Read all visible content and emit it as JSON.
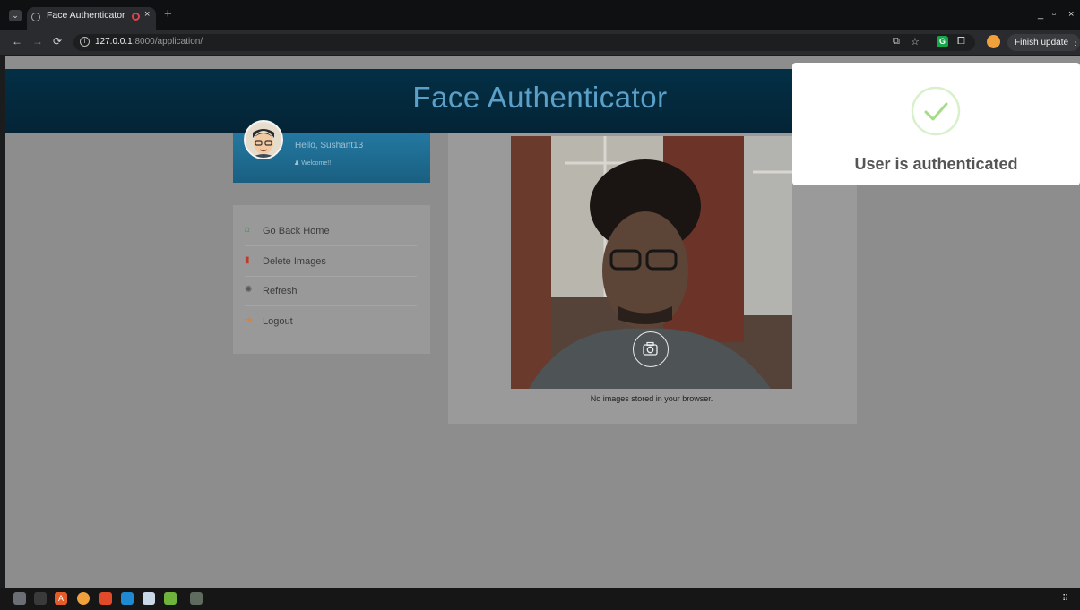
{
  "browser": {
    "tab_title": "Face Authenticator",
    "tab_close": "×",
    "new_tab": "+",
    "url_host": "127.0.0.1",
    "url_path": ":8000/application/",
    "finish_update_label": "Finish update",
    "window_controls": [
      "_",
      "▫",
      "×"
    ]
  },
  "page": {
    "app_title": "Face Authenticator",
    "profile": {
      "greeting": "Hello, Sushant13",
      "welcome": "Welcome!!"
    },
    "menu": [
      {
        "icon": "home-icon",
        "label": "Go Back Home",
        "color": "#2e8b3a"
      },
      {
        "icon": "trash-icon",
        "label": "Delete Images",
        "color": "#c0392b"
      },
      {
        "icon": "refresh-icon",
        "label": "Refresh",
        "color": "#7a7a7a"
      },
      {
        "icon": "logout-icon",
        "label": "Logout",
        "color": "#e67e22"
      }
    ],
    "no_images_text": "No images stored in your browser."
  },
  "toast": {
    "message": "User is authenticated",
    "icon": "check-circle-icon",
    "color": "#a5dc86"
  },
  "colors": {
    "banner": "#032f45",
    "profile_card": "#2378a1",
    "overlay": "#8d8d8d"
  }
}
